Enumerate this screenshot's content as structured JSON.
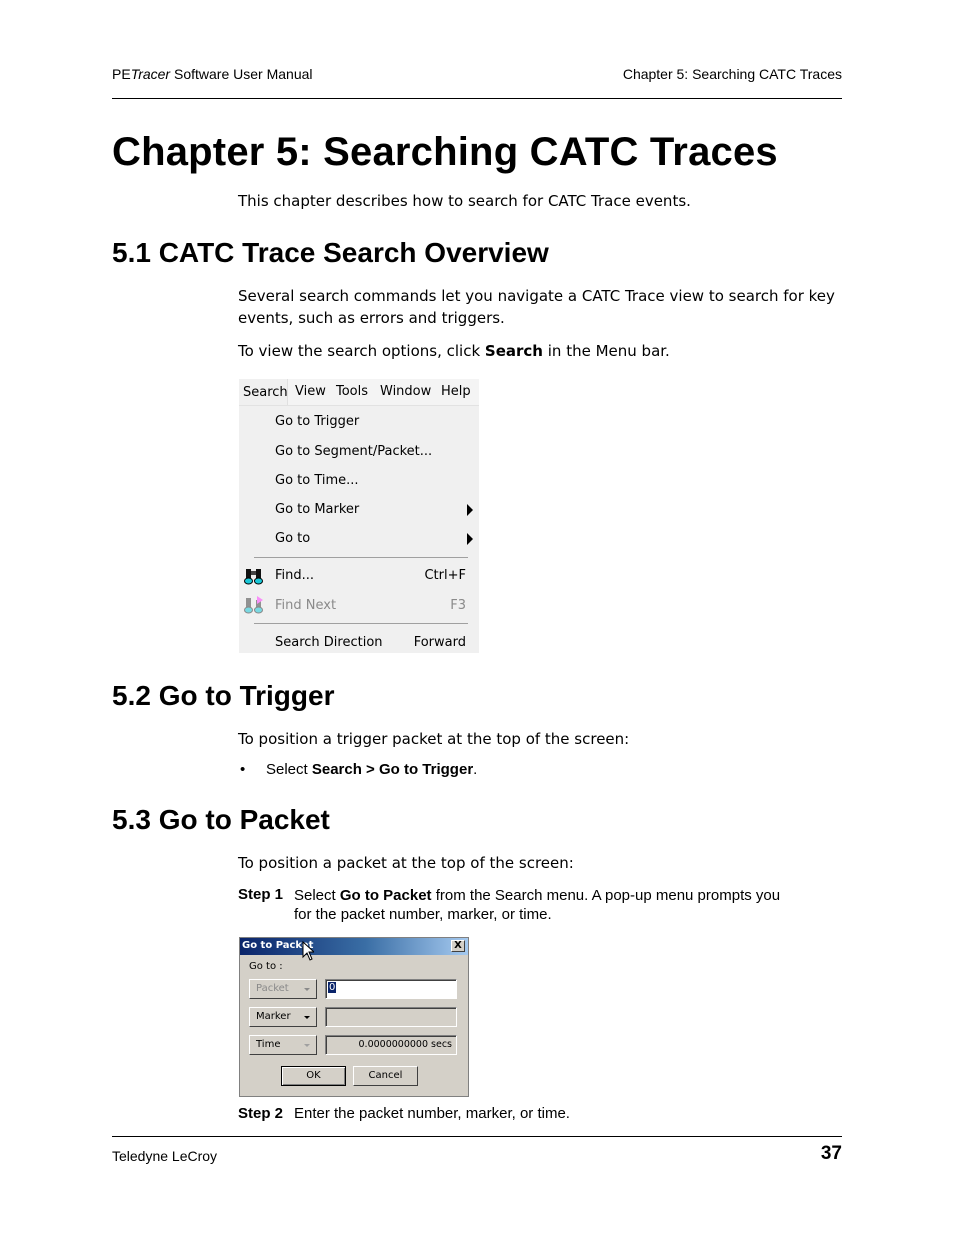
{
  "header": {
    "left_prefix": "PE",
    "left_italic": "Tracer",
    "left_suffix": " Software User Manual",
    "right": "Chapter 5: Searching CATC Traces"
  },
  "chapter_title": "Chapter 5:  Searching CATC Traces",
  "intro": "This chapter describes how to search for CATC Trace events.",
  "sections": [
    {
      "title": "5.1 CATC Trace Search Overview",
      "para1": "Several search commands let you navigate a CATC Trace view to search for key events, such as errors and triggers.",
      "para2_prefix": "To view the search options, click ",
      "para2_bold": "Search",
      "para2_suffix": " in the Menu bar."
    },
    {
      "title": "5.2 Go to Trigger",
      "para": "To position a trigger packet at the top of the screen:",
      "bullet_prefix": "Select ",
      "bullet_bold": "Search > Go to Trigger",
      "bullet_suffix": "."
    },
    {
      "title": "5.3 Go to Packet",
      "para": "To position a packet at the top of the screen:",
      "step1_label": "Step 1",
      "step1_prefix": "Select ",
      "step1_bold": "Go to Packet",
      "step1_suffix": " from the Search menu. A pop-up menu prompts you for the packet number, marker, or time.",
      "step2_label": "Step 2",
      "step2_text": "Enter the packet number, marker, or time."
    }
  ],
  "menu": {
    "menubar": [
      "Search",
      "View",
      "Tools",
      "Window",
      "Help"
    ],
    "items": [
      {
        "label": "Go to Trigger"
      },
      {
        "label": "Go to Segment/Packet..."
      },
      {
        "label": "Go to Time..."
      },
      {
        "label": "Go to Marker",
        "submenu": true
      },
      {
        "label": "Go to",
        "submenu": true
      },
      {
        "label": "Find...",
        "shortcut": "Ctrl+F",
        "icon": "binoculars-icon"
      },
      {
        "label": "Find Next",
        "shortcut": "F3",
        "icon": "binoculars-next-icon",
        "disabled": true
      },
      {
        "label": "Search Direction",
        "shortcut": "Forward"
      }
    ]
  },
  "dialog": {
    "title": "Go to Packet",
    "close": "X",
    "group_label": "Go to :",
    "packet_combo": "Packet",
    "packet_value": "0",
    "marker_combo": "Marker",
    "marker_value": "",
    "time_combo": "Time",
    "time_value": "0.0000000000 secs",
    "ok": "OK",
    "cancel": "Cancel"
  },
  "footer": {
    "left": "Teledyne LeCroy",
    "page": "37"
  }
}
